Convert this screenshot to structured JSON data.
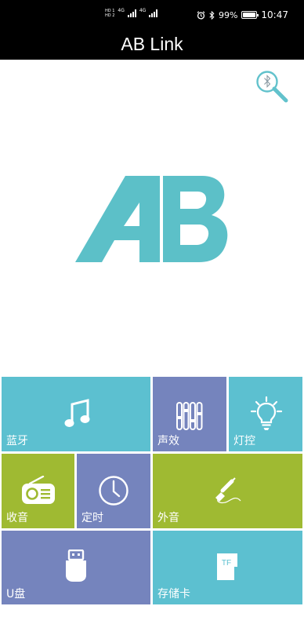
{
  "status": {
    "battery": "99%",
    "time": "10:47",
    "sim1": "HD 1",
    "sim2": "HD 2",
    "net1": "4G",
    "net2": "4G",
    "battery_level": 0.99
  },
  "app": {
    "title": "AB Link"
  },
  "logo_text": "AB",
  "tiles": {
    "bluetooth": "蓝牙",
    "sound_effect": "声效",
    "light_control": "灯控",
    "radio": "收音",
    "timer": "定时",
    "aux": "外音",
    "usb": "U盘",
    "storage_card": "存储卡",
    "tf_badge": "TF"
  },
  "colors": {
    "cyan": "#5cc0d0",
    "purple": "#7584bd",
    "green": "#9fba32",
    "logo": "#5cc0c8"
  }
}
